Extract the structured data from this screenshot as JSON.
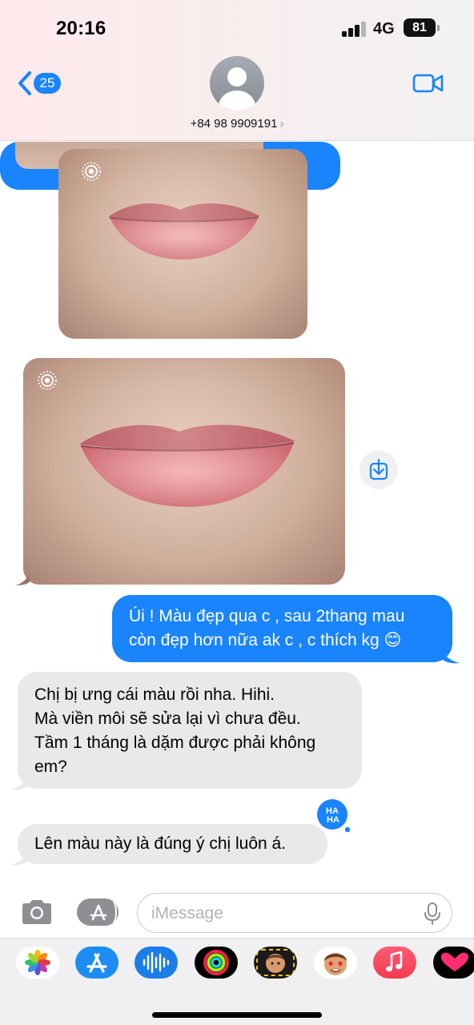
{
  "status_bar": {
    "time": "20:16",
    "network": "4G",
    "battery": "81"
  },
  "header": {
    "back_badge": "25",
    "contact_phone": "+84 98 9909191",
    "contact_chevron": "›",
    "icons": [
      "back-chevron-icon",
      "avatar-placeholder-icon",
      "video-camera-icon"
    ],
    "accent_color": "#1a84fd"
  },
  "conversation": {
    "messages": [
      {
        "type": "photo",
        "direction": "incoming",
        "content": "lips close-up photo (before)",
        "live_photo": true
      },
      {
        "type": "photo",
        "direction": "incoming",
        "content": "lips close-up photo (after)",
        "live_photo": true
      },
      {
        "type": "text",
        "direction": "outgoing",
        "lines": [
          "Úi ! Màu đẹp qua c , sau 2thang mau",
          "còn đẹp hơn nữa ak c , c thích kg 😊"
        ]
      },
      {
        "type": "text",
        "direction": "incoming",
        "lines": [
          "Chị bị ưng cái màu rồi nha. Hihi.",
          "Mà viền môi sẽ sửa lại vì chưa đều.",
          "Tầm 1 tháng là dặm được phải không",
          "em?"
        ]
      },
      {
        "type": "text",
        "direction": "incoming",
        "lines": [
          "Lên màu này là đúng ý chị luôn á."
        ],
        "tapback": "HAHA"
      }
    ],
    "outgoing_color": "#1a84fd",
    "incoming_color": "#e9e9eb"
  },
  "input_bar": {
    "placeholder": "iMessage",
    "value": "",
    "icons": [
      "camera-icon",
      "app-store-icon",
      "microphone-icon"
    ]
  },
  "app_drawer": {
    "apps": [
      "photos-icon",
      "app-store-icon",
      "audio-message-icon",
      "activity-icon",
      "memoji-icon",
      "memoji-stickers-icon",
      "music-icon",
      "digital-touch-icon"
    ]
  }
}
